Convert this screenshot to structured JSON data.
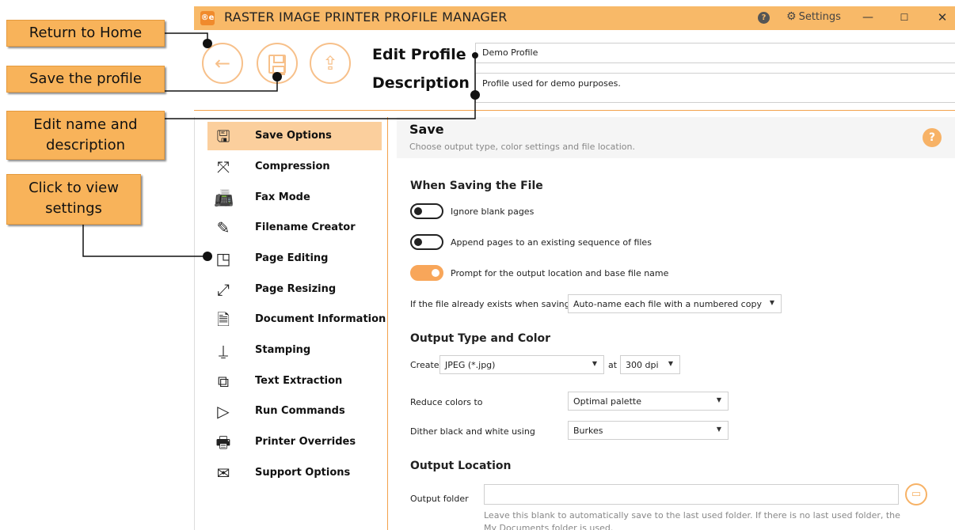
{
  "window": {
    "logo_text": "®e",
    "title": "RASTER IMAGE PRINTER PROFILE MANAGER",
    "help_label": "?",
    "settings_icon": "gear-icon",
    "settings_label": "Settings",
    "minimize_label": "—",
    "maximize_label": "☐",
    "close_label": "✕"
  },
  "header": {
    "back_icon": "←",
    "export_icon": "⇪",
    "edit_profile_label": "Edit Profile -",
    "description_label": "Description",
    "profile_name": "Demo Profile",
    "profile_description": "Profile used for demo purposes."
  },
  "nav": {
    "items": [
      {
        "label": "Save Options",
        "icon": "save-icon",
        "glyph": "🖫",
        "active": true
      },
      {
        "label": "Compression",
        "icon": "compress-icon",
        "glyph": "⤧"
      },
      {
        "label": "Fax Mode",
        "icon": "fax-icon",
        "glyph": "📠"
      },
      {
        "label": "Filename Creator",
        "icon": "filename-icon",
        "glyph": "✎"
      },
      {
        "label": "Page Editing",
        "icon": "page-edit-icon",
        "glyph": "◳"
      },
      {
        "label": "Page Resizing",
        "icon": "resize-icon",
        "glyph": "⤢"
      },
      {
        "label": "Document Information",
        "icon": "doc-info-icon",
        "glyph": "🗎"
      },
      {
        "label": "Stamping",
        "icon": "stamp-icon",
        "glyph": "⍊"
      },
      {
        "label": "Text Extraction",
        "icon": "text-extract-icon",
        "glyph": "⧉"
      },
      {
        "label": "Run Commands",
        "icon": "run-icon",
        "glyph": "▷"
      },
      {
        "label": "Printer Overrides",
        "icon": "printer-icon",
        "glyph": "🖶"
      },
      {
        "label": "Support Options",
        "icon": "support-icon",
        "glyph": "✉"
      }
    ]
  },
  "panel": {
    "title": "Save",
    "subtitle": "Choose output type, color settings and file location.",
    "help_label": "?",
    "when_saving_title": "When Saving the File",
    "toggles": [
      {
        "label": "Ignore blank pages",
        "on": false
      },
      {
        "label": "Append pages to an existing sequence of files",
        "on": false
      },
      {
        "label": "Prompt for the output location and base file name",
        "on": true
      }
    ],
    "exists_label": "If the file already exists when saving",
    "exists_value": "Auto-name each file with a numbered copy",
    "output_type_title": "Output Type and Color",
    "create_label": "Create",
    "create_value": "JPEG (*.jpg)",
    "at_label": "at",
    "dpi_value": "300 dpi",
    "reduce_label": "Reduce colors to",
    "reduce_value": "Optimal palette",
    "dither_label": "Dither black and white using",
    "dither_value": "Burkes",
    "output_location_title": "Output Location",
    "output_folder_label": "Output folder",
    "output_folder_value": "",
    "output_folder_hint": "Leave this blank to automatically save to the last used folder. If there is no last used folder, the My Documents folder is used."
  },
  "annotations": {
    "return_home": "Return to Home",
    "save_profile": "Save the profile",
    "edit_name_1": "Edit name and",
    "edit_name_2": "description",
    "click_view_1": "Click to view",
    "click_view_2": "settings"
  },
  "colors": {
    "accent": "#f8b968",
    "accent_dark": "#f3a24c",
    "callout": "#f8b35a",
    "active_nav": "#fbcf9d"
  }
}
